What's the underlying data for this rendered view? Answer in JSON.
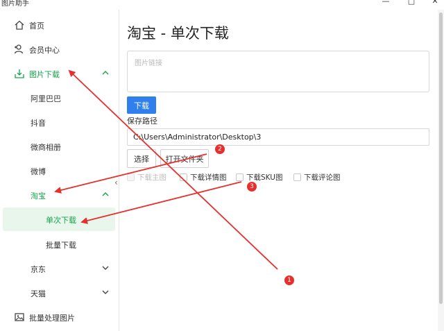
{
  "window": {
    "title": "图片助手",
    "minimize": "—",
    "maximize": "□",
    "close": "✕"
  },
  "sidebar": {
    "home": "首页",
    "member": "会员中心",
    "download": "图片下载",
    "alibaba": "阿里巴巴",
    "douyin": "抖音",
    "weishang": "微商相册",
    "weibo": "微博",
    "taobao": "淘宝",
    "single": "单次下载",
    "batch": "批量下载",
    "jd": "京东",
    "tmall": "天猫",
    "batch_process": "批量处理图片",
    "collapse": "‹"
  },
  "main": {
    "title": "淘宝 - 单次下载",
    "link_placeholder": "图片链接",
    "download_button": "下载",
    "save_path_label": "保存路径",
    "save_path_value": "C:\\Users\\Administrator\\Desktop\\3",
    "choose_button": "选择",
    "open_folder_button": "打开文件夹",
    "options": [
      {
        "label": "下载主图",
        "checked": false,
        "disabled": true
      },
      {
        "label": "下载详情图",
        "checked": false,
        "disabled": false
      },
      {
        "label": "下载SKU图",
        "checked": false,
        "disabled": false
      },
      {
        "label": "下载评论图",
        "checked": false,
        "disabled": false
      }
    ]
  },
  "annotations": {
    "badges": [
      "1",
      "2",
      "3"
    ],
    "arrow_color": "#e5302d"
  },
  "colors": {
    "accent_green": "#16a34a",
    "primary_blue": "#2f80ed"
  }
}
